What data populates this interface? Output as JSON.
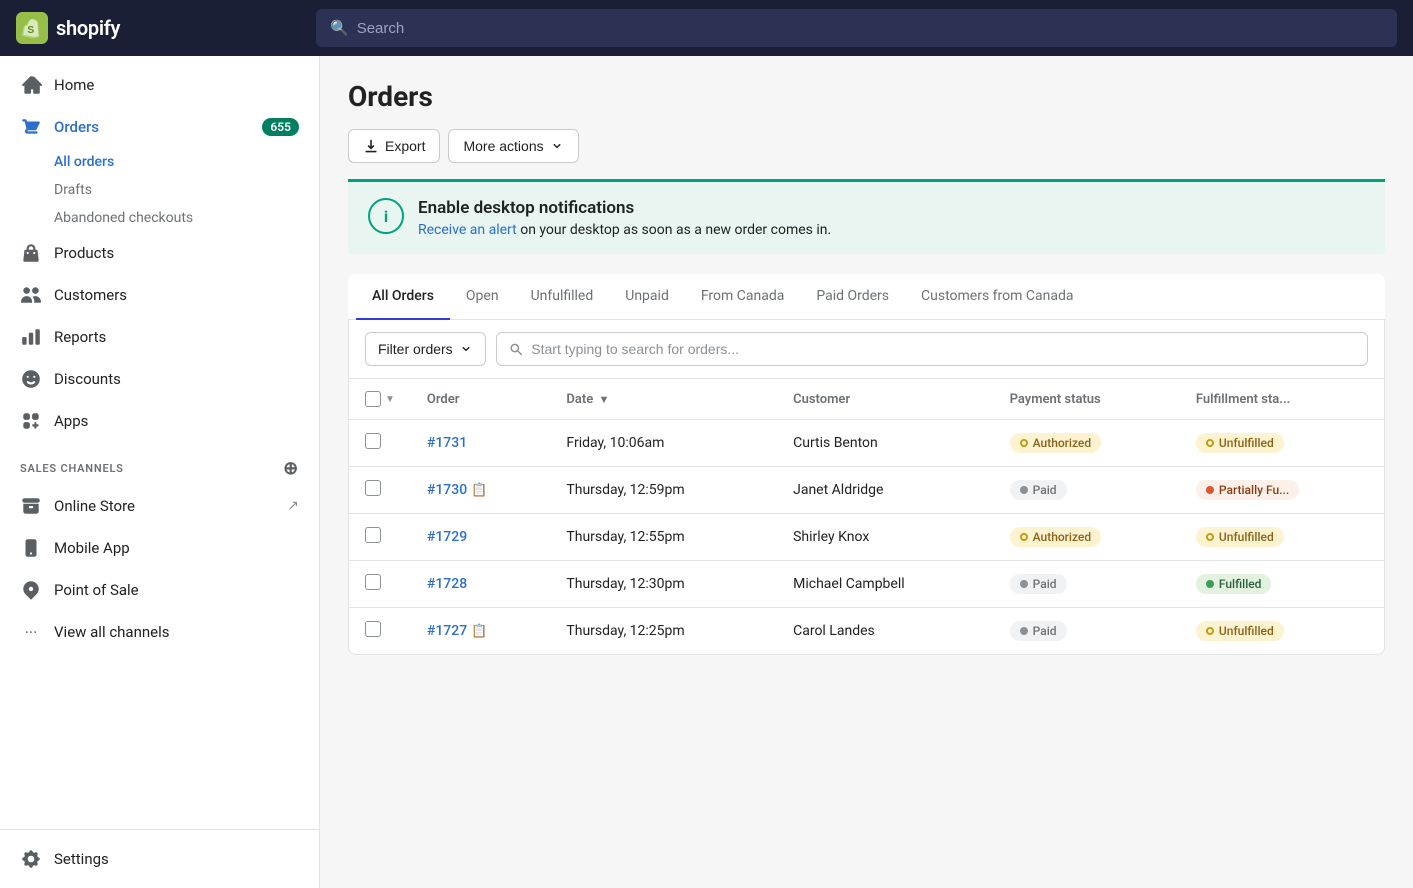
{
  "topbar": {
    "logo_text": "shopify",
    "search_placeholder": "Search"
  },
  "sidebar": {
    "nav_items": [
      {
        "id": "home",
        "label": "Home",
        "icon": "home"
      },
      {
        "id": "orders",
        "label": "Orders",
        "icon": "orders",
        "badge": "655",
        "active": true
      },
      {
        "id": "products",
        "label": "Products",
        "icon": "products"
      },
      {
        "id": "customers",
        "label": "Customers",
        "icon": "customers"
      },
      {
        "id": "reports",
        "label": "Reports",
        "icon": "reports"
      },
      {
        "id": "discounts",
        "label": "Discounts",
        "icon": "discounts"
      },
      {
        "id": "apps",
        "label": "Apps",
        "icon": "apps"
      }
    ],
    "orders_subnav": [
      {
        "id": "all-orders",
        "label": "All orders",
        "active": true
      },
      {
        "id": "drafts",
        "label": "Drafts"
      },
      {
        "id": "abandoned-checkouts",
        "label": "Abandoned checkouts"
      }
    ],
    "sales_channels_label": "SALES CHANNELS",
    "sales_channels": [
      {
        "id": "online-store",
        "label": "Online Store",
        "has_ext": true
      },
      {
        "id": "mobile-app",
        "label": "Mobile App"
      },
      {
        "id": "point-of-sale",
        "label": "Point of Sale"
      }
    ],
    "view_all_channels": "View all channels",
    "settings_label": "Settings"
  },
  "page": {
    "title": "Orders",
    "export_label": "Export",
    "more_actions_label": "More actions"
  },
  "notification": {
    "title": "Enable desktop notifications",
    "body_text": " on your desktop as soon as a new order comes in.",
    "link_text": "Receive an alert"
  },
  "tabs": [
    {
      "id": "all-orders",
      "label": "All Orders",
      "active": true
    },
    {
      "id": "open",
      "label": "Open"
    },
    {
      "id": "unfulfilled",
      "label": "Unfulfilled"
    },
    {
      "id": "unpaid",
      "label": "Unpaid"
    },
    {
      "id": "from-canada",
      "label": "From Canada"
    },
    {
      "id": "paid-orders",
      "label": "Paid Orders"
    },
    {
      "id": "customers-from-canada",
      "label": "Customers from Canada"
    }
  ],
  "filter": {
    "filter_label": "Filter orders",
    "search_placeholder": "Start typing to search for orders..."
  },
  "table": {
    "headers": [
      {
        "id": "order",
        "label": "Order"
      },
      {
        "id": "date",
        "label": "Date",
        "sortable": true
      },
      {
        "id": "customer",
        "label": "Customer"
      },
      {
        "id": "payment_status",
        "label": "Payment status"
      },
      {
        "id": "fulfillment_status",
        "label": "Fulfillment sta..."
      }
    ],
    "rows": [
      {
        "id": "1731",
        "order": "#1731",
        "has_note": false,
        "date": "Friday, 10:06am",
        "customer": "Curtis Benton",
        "payment_status": "Authorized",
        "payment_badge": "yellow",
        "fulfillment_status": "Unfulfilled",
        "fulfillment_badge": "yellow"
      },
      {
        "id": "1730",
        "order": "#1730",
        "has_note": true,
        "date": "Thursday, 12:59pm",
        "customer": "Janet Aldridge",
        "payment_status": "Paid",
        "payment_badge": "gray",
        "fulfillment_status": "Partially Fu...",
        "fulfillment_badge": "orange"
      },
      {
        "id": "1729",
        "order": "#1729",
        "has_note": false,
        "date": "Thursday, 12:55pm",
        "customer": "Shirley Knox",
        "payment_status": "Authorized",
        "payment_badge": "yellow",
        "fulfillment_status": "Unfulfilled",
        "fulfillment_badge": "yellow"
      },
      {
        "id": "1728",
        "order": "#1728",
        "has_note": false,
        "date": "Thursday, 12:30pm",
        "customer": "Michael Campbell",
        "payment_status": "Paid",
        "payment_badge": "gray",
        "fulfillment_status": "Fulfilled",
        "fulfillment_badge": "green"
      },
      {
        "id": "1727",
        "order": "#1727",
        "has_note": true,
        "date": "Thursday, 12:25pm",
        "customer": "Carol Landes",
        "payment_status": "Paid",
        "payment_badge": "gray",
        "fulfillment_status": "Unfulfilled",
        "fulfillment_badge": "yellow"
      }
    ]
  }
}
